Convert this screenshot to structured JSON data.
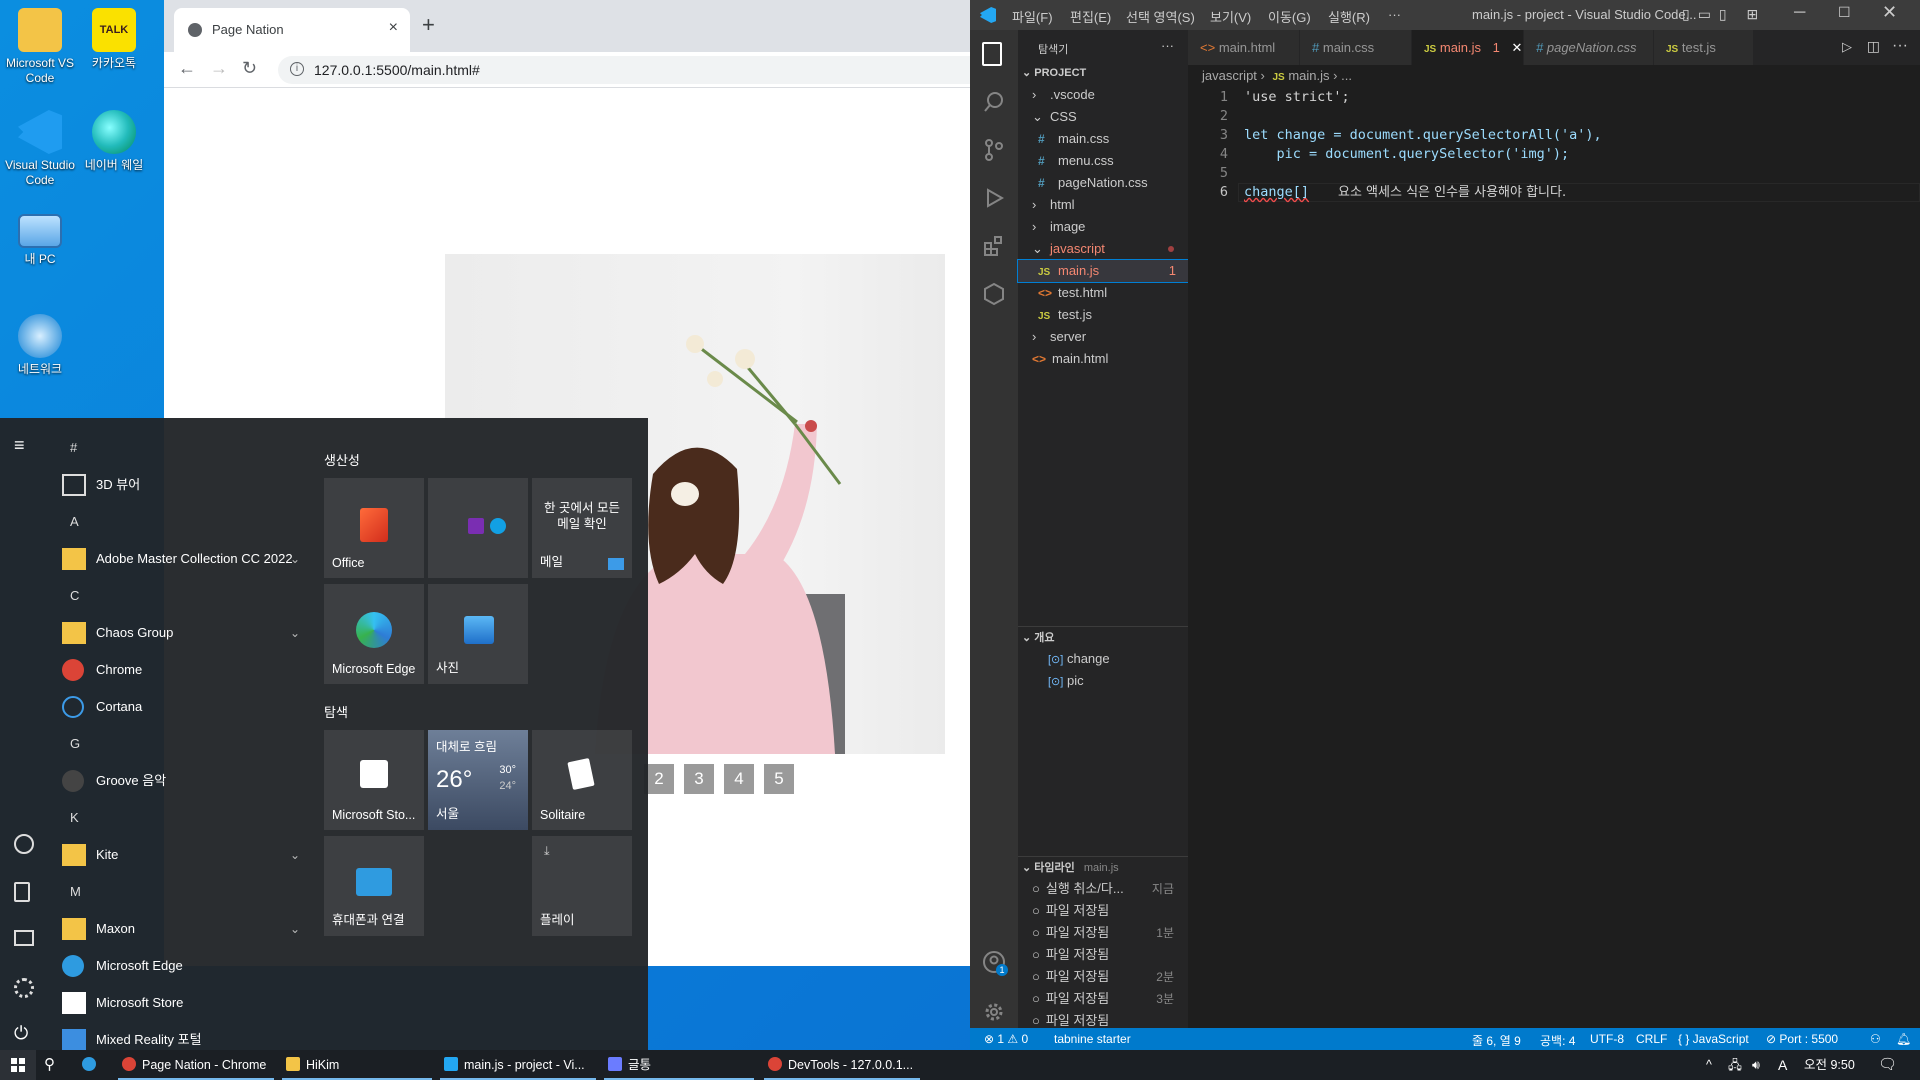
{
  "desktop": {
    "icons": [
      {
        "label": "Microsoft VS Code",
        "icon": "folder-icon"
      },
      {
        "label": "카카오톡",
        "icon": "kakaotalk-icon",
        "badge": "TALK"
      },
      {
        "label": "Visual Studio Code",
        "icon": "vscode-icon"
      },
      {
        "label": "네이버 웨일",
        "icon": "whale-icon"
      },
      {
        "label": "내 PC",
        "icon": "computer-icon"
      },
      {
        "label": "네트워크",
        "icon": "network-icon"
      }
    ]
  },
  "chrome": {
    "tab_title": "Page Nation",
    "url": "127.0.0.1:5500/main.html#",
    "pager": [
      "2",
      "3",
      "4",
      "5"
    ]
  },
  "vscode": {
    "menu": [
      "파일(F)",
      "편집(E)",
      "선택 영역(S)",
      "보기(V)",
      "이동(G)",
      "실행(R)",
      "···"
    ],
    "window_title": "main.js - project - Visual Studio Code...",
    "explorer": {
      "header": "탐색기",
      "more": "···",
      "project": "PROJECT",
      "tree": [
        {
          "label": ".vscode",
          "type": "folder",
          "depth": 1,
          "open": false
        },
        {
          "label": "CSS",
          "type": "folder",
          "depth": 1,
          "open": true
        },
        {
          "label": "main.css",
          "type": "css",
          "depth": 2
        },
        {
          "label": "menu.css",
          "type": "css",
          "depth": 2
        },
        {
          "label": "pageNation.css",
          "type": "css",
          "depth": 2
        },
        {
          "label": "html",
          "type": "folder",
          "depth": 1,
          "open": false
        },
        {
          "label": "image",
          "type": "folder",
          "depth": 1,
          "open": false
        },
        {
          "label": "javascript",
          "type": "folder",
          "depth": 1,
          "open": true,
          "error": true
        },
        {
          "label": "main.js",
          "type": "js",
          "depth": 2,
          "error": true,
          "count": "1",
          "selected": true
        },
        {
          "label": "test.html",
          "type": "html",
          "depth": 2
        },
        {
          "label": "test.js",
          "type": "js",
          "depth": 2
        },
        {
          "label": "server",
          "type": "folder",
          "depth": 1,
          "open": false
        },
        {
          "label": "main.html",
          "type": "html",
          "depth": 1
        }
      ],
      "outline_title": "개요",
      "outline": [
        "change",
        "pic"
      ],
      "timeline_title": "타임라인",
      "timeline_file": "main.js",
      "timeline": [
        {
          "label": "실행 취소/다...",
          "time": "지금"
        },
        {
          "label": "파일 저장됨",
          "time": ""
        },
        {
          "label": "파일 저장됨",
          "time": "1분"
        },
        {
          "label": "파일 저장됨",
          "time": ""
        },
        {
          "label": "파일 저장됨",
          "time": "2분"
        },
        {
          "label": "파일 저장됨",
          "time": "3분"
        },
        {
          "label": "파일 저장됨",
          "time": ""
        },
        {
          "label": "파일 저장됨",
          "time": ""
        }
      ]
    },
    "tabs": [
      {
        "label": "main.html",
        "type": "html"
      },
      {
        "label": "main.css",
        "type": "css"
      },
      {
        "label": "main.js",
        "type": "js",
        "active": true,
        "count": "1"
      },
      {
        "label": "pageNation.css",
        "type": "css",
        "italic": true
      },
      {
        "label": "test.js",
        "type": "js"
      }
    ],
    "breadcrumb": [
      "javascript",
      "main.js",
      "..."
    ],
    "code_lines": [
      {
        "n": "1",
        "text": "'use strict';"
      },
      {
        "n": "2",
        "text": ""
      },
      {
        "n": "3",
        "text": "let change = document.querySelectorAll('a'),"
      },
      {
        "n": "4",
        "text": "    pic = document.querySelector('img');"
      },
      {
        "n": "5",
        "text": ""
      },
      {
        "n": "6",
        "text": "change[]"
      }
    ],
    "inline_error": "요소 액세스 식은 인수를 사용해야 합니다.",
    "status": {
      "problems": "⊗ 1 ⚠ 0",
      "tabnine": "tabnine starter",
      "position": "줄 6, 열 9",
      "spaces": "공백: 4",
      "encoding": "UTF-8",
      "eol": "CRLF",
      "language": "{ } JavaScript",
      "port": "⊘ Port : 5500"
    },
    "account_badge": "1"
  },
  "startmenu": {
    "apps": [
      {
        "kind": "letter",
        "label": "#"
      },
      {
        "kind": "app",
        "label": "3D 뷰어",
        "icon": "cube-icon"
      },
      {
        "kind": "letter",
        "label": "A"
      },
      {
        "kind": "folder",
        "label": "Adobe Master Collection CC 2022",
        "icon": "folder-icon"
      },
      {
        "kind": "letter",
        "label": "C"
      },
      {
        "kind": "folder",
        "label": "Chaos Group",
        "icon": "folder-icon"
      },
      {
        "kind": "app",
        "label": "Chrome",
        "icon": "chrome-icon"
      },
      {
        "kind": "app",
        "label": "Cortana",
        "icon": "cortana-icon"
      },
      {
        "kind": "letter",
        "label": "G"
      },
      {
        "kind": "app",
        "label": "Groove 음악",
        "icon": "groove-icon"
      },
      {
        "kind": "letter",
        "label": "K"
      },
      {
        "kind": "folder",
        "label": "Kite",
        "icon": "folder-icon"
      },
      {
        "kind": "letter",
        "label": "M"
      },
      {
        "kind": "folder",
        "label": "Maxon",
        "icon": "folder-icon"
      },
      {
        "kind": "app",
        "label": "Microsoft Edge",
        "icon": "edge-icon"
      },
      {
        "kind": "app",
        "label": "Microsoft Store",
        "icon": "store-icon"
      },
      {
        "kind": "app",
        "label": "Mixed Reality 포털",
        "icon": "mixed-reality-icon"
      }
    ],
    "group_productivity": "생산성",
    "group_explore": "탐색",
    "tiles": {
      "office": "Office",
      "mail_text": "한 곳에서 모든 메일 확인",
      "mail": "메일",
      "edge": "Microsoft Edge",
      "photos": "사진",
      "store": "Microsoft Sto...",
      "weather_cond": "대체로 흐림",
      "weather_temp": "26°",
      "weather_high": "30°",
      "weather_low": "24°",
      "weather_city": "서울",
      "solitaire": "Solitaire",
      "phone": "휴대폰과 연결",
      "play": "플레이"
    }
  },
  "taskbar": {
    "items": [
      {
        "label": "Page Nation - Chrome",
        "icon": "chrome-icon"
      },
      {
        "label": "HiKim",
        "icon": "folder-icon"
      },
      {
        "label": "main.js - project - Vi...",
        "icon": "vscode-icon"
      },
      {
        "label": "글통",
        "icon": "app-icon"
      },
      {
        "label": "DevTools - 127.0.0.1...",
        "icon": "chrome-icon"
      }
    ],
    "ime": "A",
    "clock": "오전 9:50"
  }
}
